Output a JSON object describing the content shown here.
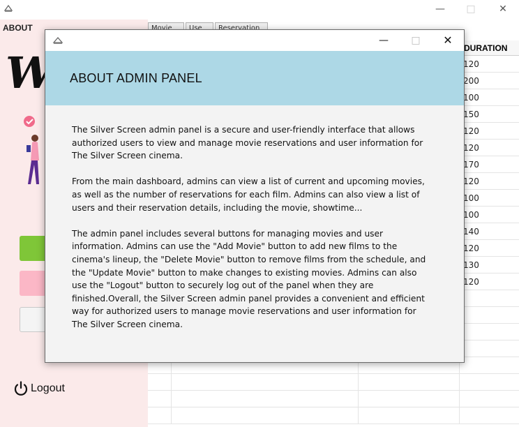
{
  "main_window": {
    "tabs": [
      "Movie",
      "Use",
      "Reservation"
    ],
    "about_label": "ABOUT",
    "logo_text": "W",
    "logout_label": "Logout",
    "table": {
      "visible_column_header": "DURATION",
      "duration_values": [
        "120",
        "200",
        "100",
        "150",
        "120",
        "120",
        "170",
        "120",
        "100",
        "100",
        "140",
        "120",
        "130",
        "120",
        "",
        "",
        "",
        "",
        "",
        "",
        "",
        ""
      ]
    }
  },
  "about_dialog": {
    "header_title": "ABOUT ADMIN PANEL",
    "paragraphs": [
      "The Silver Screen admin panel is a secure and user-friendly interface that allows authorized users to view and manage movie reservations and user information for The Silver Screen cinema.",
      "From the main dashboard, admins can view a list of current and upcoming movies, as well as the number of reservations for each film. Admins can also view a list of users and their reservation details, including the movie, showtime...",
      "The admin panel includes several buttons for managing movies and user information. Admins can use the \"Add Movie\" button to add new films to the cinema's lineup, the \"Delete Movie\" button to remove films from the schedule, and the \"Update Movie\" button to make changes to existing movies. Admins can also use the \"Logout\" button to securely log out of the panel when they are finished.Overall, the Silver Screen admin panel provides a convenient and efficient way for authorized users to manage movie reservations and user information for The Silver Screen cinema."
    ]
  },
  "colors": {
    "header_bg": "#add8e6",
    "sidebar_bg": "#fbeaea",
    "green_button": "#7fc638",
    "pink_button": "#fbb7c6"
  },
  "icons": [
    "java-app-icon",
    "minimize-icon",
    "maximize-icon",
    "close-icon",
    "power-icon",
    "illustration-image"
  ]
}
